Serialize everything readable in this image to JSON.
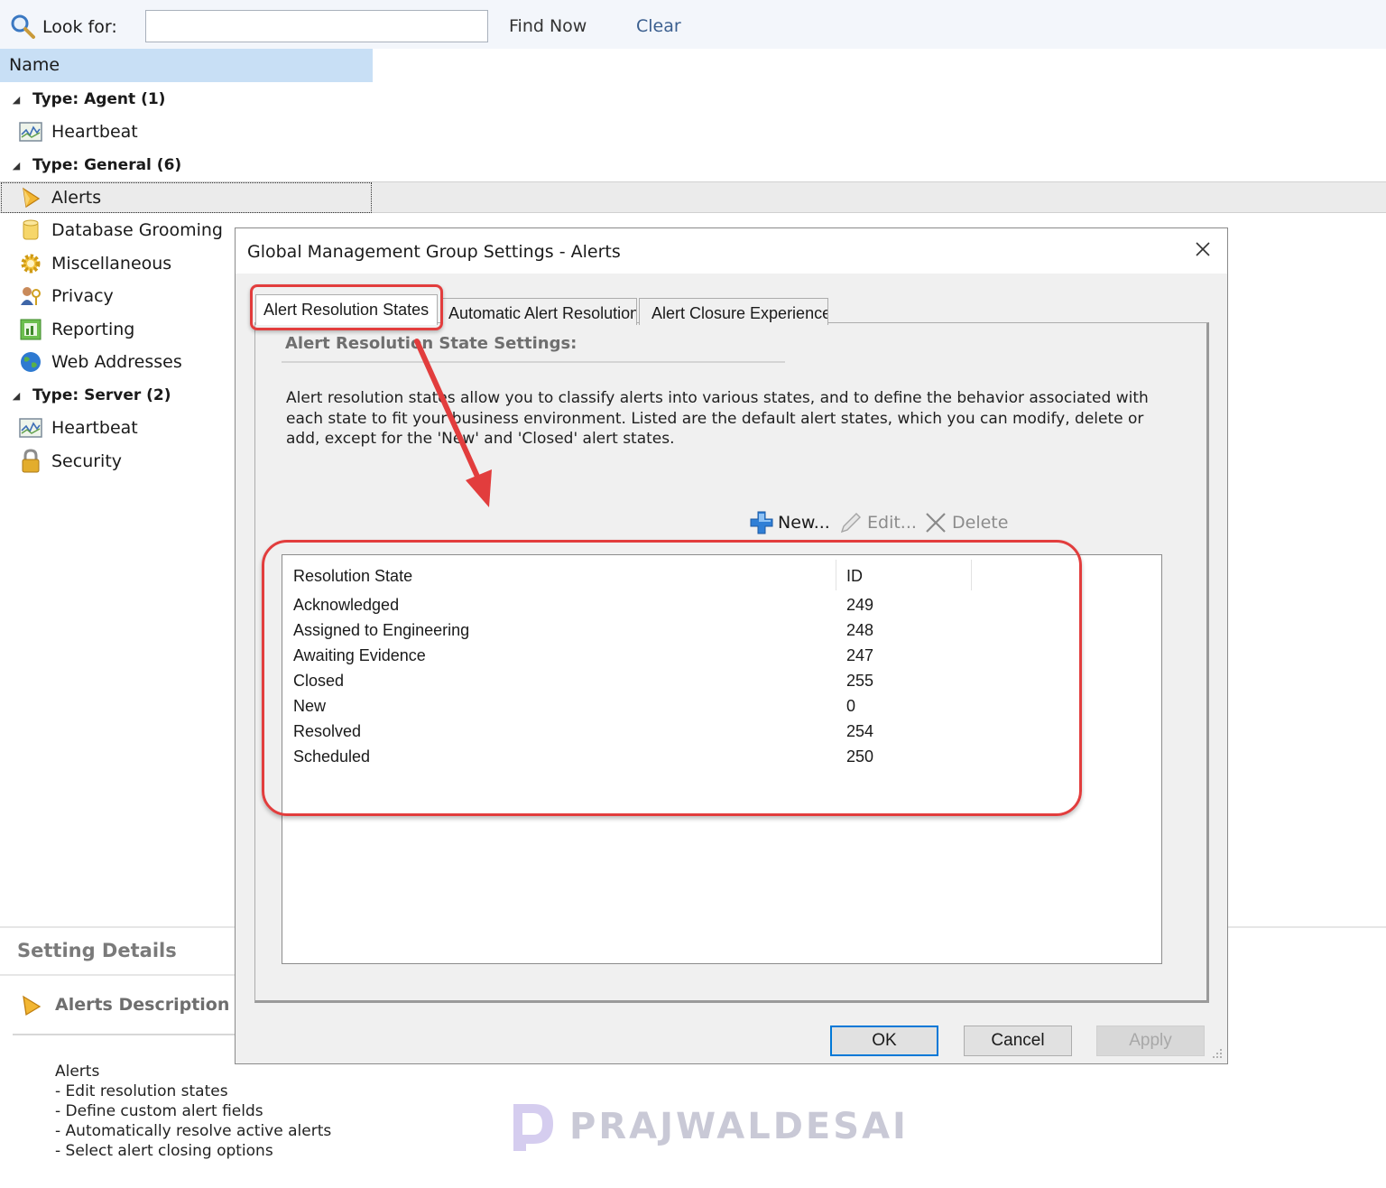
{
  "search": {
    "look_for_label": "Look for:",
    "input_value": "",
    "find_now_label": "Find Now",
    "clear_label": "Clear"
  },
  "list_header": {
    "name_label": "Name"
  },
  "tree": {
    "groups": [
      {
        "label": "Type: Agent (1)"
      },
      {
        "label": "Type: General (6)"
      },
      {
        "label": "Type: Server (2)"
      }
    ],
    "items": [
      {
        "label": "Heartbeat",
        "icon": "heartbeat-monitor-icon"
      },
      {
        "label": "Alerts",
        "icon": "alert-bell-icon",
        "selected": true
      },
      {
        "label": "Database Grooming",
        "icon": "database-icon"
      },
      {
        "label": "Miscellaneous",
        "icon": "gear-icon"
      },
      {
        "label": "Privacy",
        "icon": "users-key-icon"
      },
      {
        "label": "Reporting",
        "icon": "report-chart-icon"
      },
      {
        "label": "Web Addresses",
        "icon": "globe-icon"
      },
      {
        "label": "Heartbeat",
        "icon": "heartbeat-monitor-icon"
      },
      {
        "label": "Security",
        "icon": "lock-icon"
      }
    ]
  },
  "details": {
    "heading": "Setting Details",
    "subheading": "Alerts Description",
    "lines": [
      "Alerts",
      "- Edit resolution states",
      "- Define custom alert fields",
      "- Automatically resolve active alerts",
      "- Select alert closing options"
    ]
  },
  "dialog": {
    "title": "Global Management Group Settings - Alerts",
    "tabs": [
      {
        "label": "Alert Resolution States",
        "active": true
      },
      {
        "label": "Automatic Alert Resolution",
        "active": false
      },
      {
        "label": "Alert Closure Experience",
        "active": false
      }
    ],
    "section_title": "Alert Resolution State Settings:",
    "intro": "Alert resolution states allow you to classify alerts into various states, and to define the behavior associated with each state to fit your business environment. Listed are the default alert states, which you can modify, delete or add, except for the 'New' and 'Closed' alert states.",
    "toolbar": {
      "new_label": "New...",
      "edit_label": "Edit...",
      "delete_label": "Delete"
    },
    "table": {
      "columns": [
        "Resolution State",
        "ID"
      ],
      "rows": [
        {
          "state": "Acknowledged",
          "id": "249"
        },
        {
          "state": "Assigned to Engineering",
          "id": "248"
        },
        {
          "state": "Awaiting Evidence",
          "id": "247"
        },
        {
          "state": "Closed",
          "id": "255"
        },
        {
          "state": "New",
          "id": "0"
        },
        {
          "state": "Resolved",
          "id": "254"
        },
        {
          "state": "Scheduled",
          "id": "250"
        }
      ]
    },
    "buttons": {
      "ok": "OK",
      "cancel": "Cancel",
      "apply": "Apply"
    }
  },
  "watermark": {
    "text": "PRAJWALDESAI"
  },
  "colors": {
    "selection_blue": "#c8dff5",
    "annotation_red": "#e23d3d",
    "ok_border": "#0078d7",
    "plus_blue": "#2f7fd6"
  }
}
